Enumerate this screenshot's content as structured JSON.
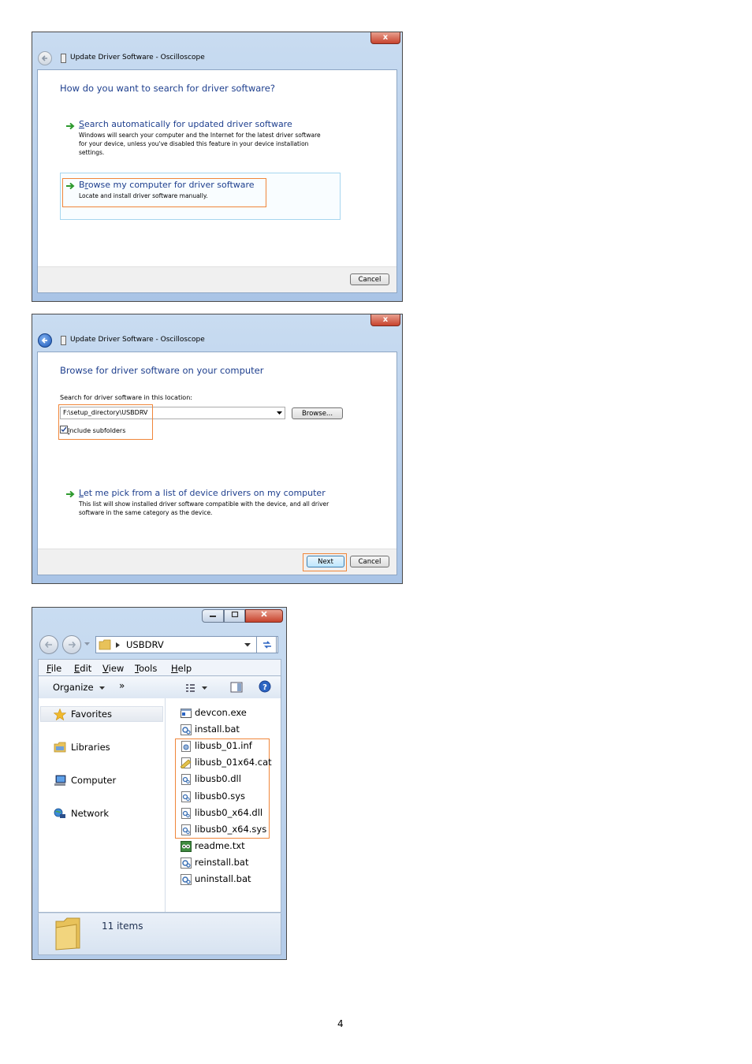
{
  "dialog1": {
    "close_label": "x",
    "title": "Update Driver Software - Oscilloscope",
    "heading": "How do you want to search for driver software?",
    "option1": {
      "accesskey": "S",
      "title_rest": "earch automatically for updated driver software",
      "desc": [
        "Windows will search your computer and the Internet for the latest driver software",
        "for your device, unless you've disabled this feature in your device installation",
        "settings."
      ]
    },
    "option2": {
      "title_start": "B",
      "accesskey": "r",
      "title_rest": "owse my computer for driver software",
      "desc": "Locate and install driver software manually."
    },
    "cancel_label": "Cancel"
  },
  "dialog2": {
    "close_label": "x",
    "title": "Update Driver Software - Oscilloscope",
    "heading": "Browse for driver software on your computer",
    "search_label": "Search for driver software in this location:",
    "path_value": "F:\\setup_directory\\USBDRV",
    "browse_label": "Browse...",
    "include_subfolders": {
      "checked": true,
      "accesskey": "I",
      "label_rest": "nclude subfolders"
    },
    "option": {
      "accesskey": "L",
      "title_rest": "et me pick from a list of device drivers on my computer",
      "desc": [
        "This list will show installed driver software compatible with the device, and all driver",
        "software in the same category as the device."
      ]
    },
    "next_label": "Next",
    "cancel_label": "Cancel"
  },
  "explorer": {
    "address": "USBDRV",
    "menus": [
      {
        "accesskey": "F",
        "rest": "ile"
      },
      {
        "accesskey": "E",
        "rest": "dit"
      },
      {
        "accesskey": "V",
        "rest": "iew"
      },
      {
        "accesskey": "T",
        "rest": "ools"
      },
      {
        "accesskey": "H",
        "rest": "elp"
      }
    ],
    "toolbar": {
      "organize": "Organize",
      "more": "»"
    },
    "nav": {
      "favorites": "Favorites",
      "libraries": "Libraries",
      "computer": "Computer",
      "network": "Network"
    },
    "files": [
      {
        "name": "devcon.exe",
        "icon": "exe-icon"
      },
      {
        "name": "install.bat",
        "icon": "bat-icon"
      },
      {
        "name": "libusb_01.inf",
        "icon": "inf-icon"
      },
      {
        "name": "libusb_01x64.cat",
        "icon": "cat-icon"
      },
      {
        "name": "libusb0.dll",
        "icon": "dll-icon"
      },
      {
        "name": "libusb0.sys",
        "icon": "sys-icon"
      },
      {
        "name": "libusb0_x64.dll",
        "icon": "dll-icon"
      },
      {
        "name": "libusb0_x64.sys",
        "icon": "sys-icon"
      },
      {
        "name": "readme.txt",
        "icon": "txt-icon"
      },
      {
        "name": "reinstall.bat",
        "icon": "bat-icon"
      },
      {
        "name": "uninstall.bat",
        "icon": "bat-icon"
      }
    ],
    "status": "11 items"
  },
  "page_number": "4",
  "colors": {
    "link_blue": "#1e3f8e",
    "highlight_orange": "#f0863a",
    "arrow_green": "#2e9a2e"
  }
}
